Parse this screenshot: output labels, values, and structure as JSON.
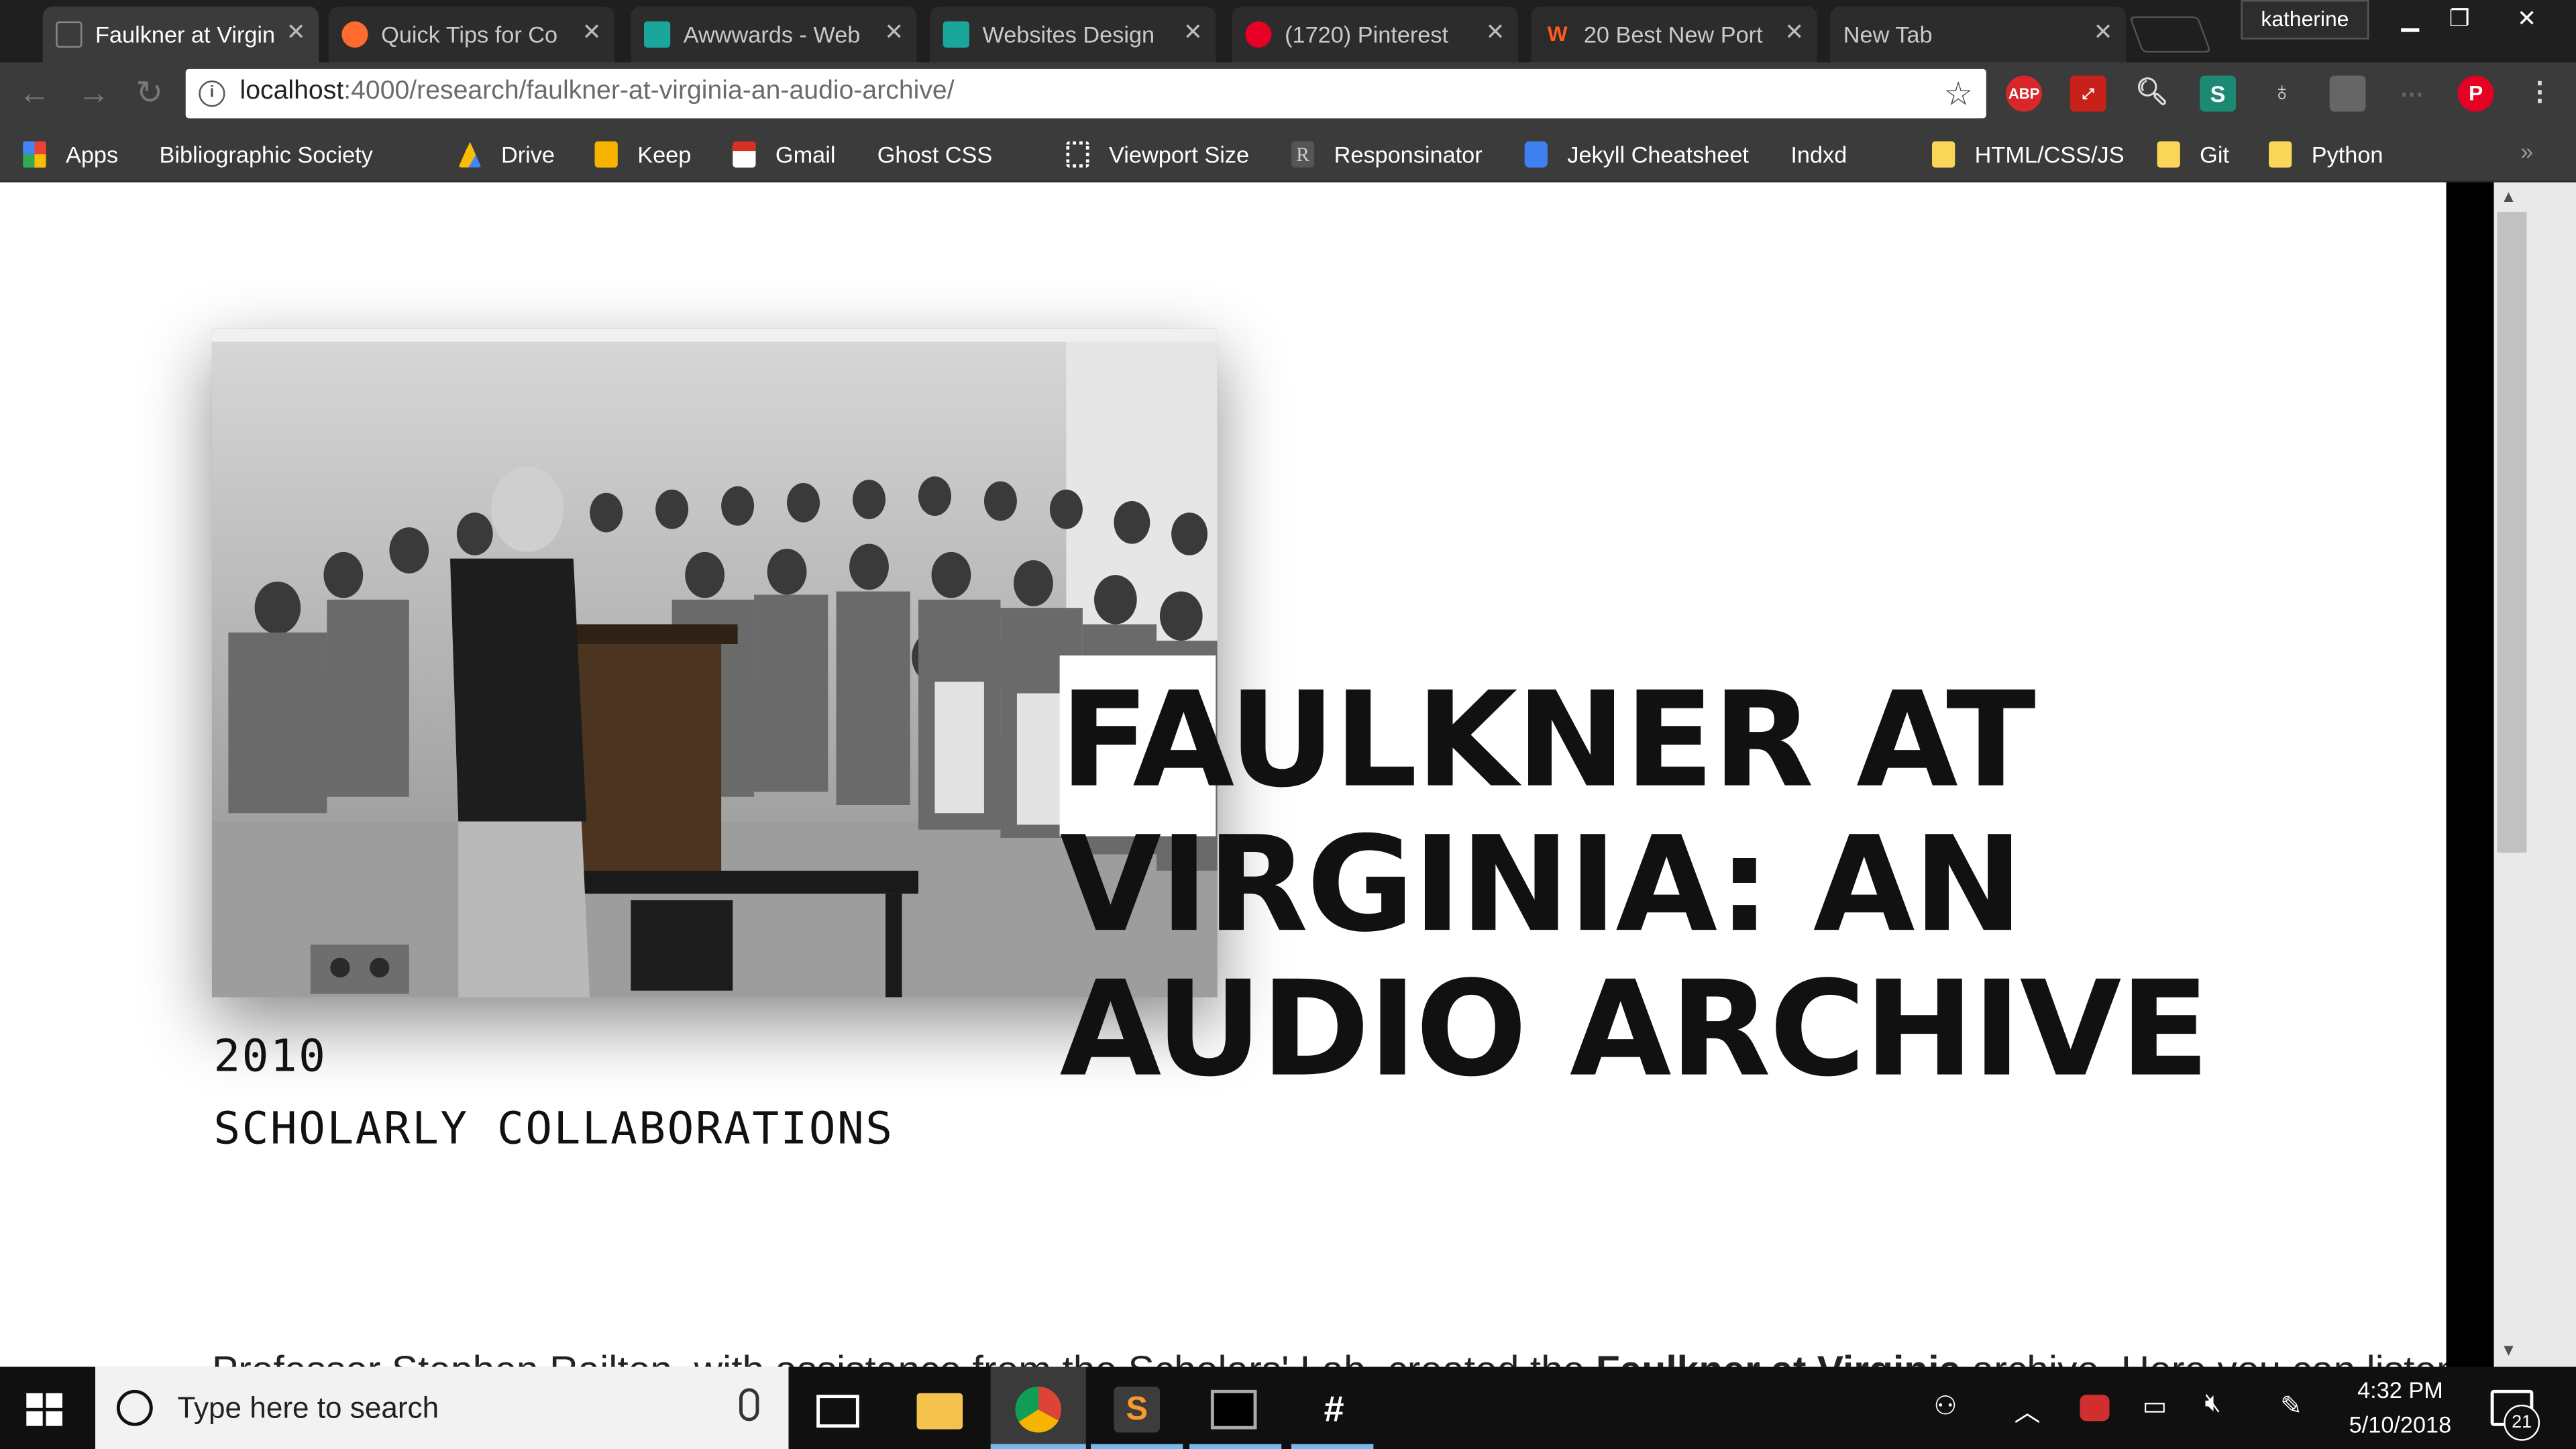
{
  "browser": {
    "tabs": [
      {
        "title": "Faulkner at Virgin",
        "active": true
      },
      {
        "title": "Quick Tips for Co",
        "active": false
      },
      {
        "title": "Awwwards - Web",
        "active": false
      },
      {
        "title": "Websites Design",
        "active": false
      },
      {
        "title": "(1720) Pinterest",
        "active": false
      },
      {
        "title": "20 Best New Port",
        "active": false
      },
      {
        "title": "New Tab",
        "active": false
      }
    ],
    "profile_name": "katherine",
    "address": {
      "host": "localhost",
      "rest": ":4000/research/faulkner-at-virginia-an-audio-archive/"
    },
    "extensions": [
      "ABP"
    ],
    "bookmarks": [
      "Apps",
      "Bibliographic Society",
      "Drive",
      "Keep",
      "Gmail",
      "Ghost CSS",
      "Viewport Size",
      "Responsinator",
      "Jekyll Cheatsheet",
      "Indxd",
      "HTML/CSS/JS",
      "Git",
      "Python"
    ],
    "bookmark_more": "»"
  },
  "page": {
    "title": "FAULKNER AT VIRGINIA: AN AUDIO ARCHIVE",
    "year": "2010",
    "category": "SCHOLARLY COLLABORATIONS",
    "intro_start": "Professor Stephen Railton, with assistance from the Scholars' Lab, created the ",
    "intro_bold": "Faulkner at Virginia",
    "intro_end": " archive. Here you can listen"
  },
  "taskbar": {
    "search_placeholder": "Type here to search",
    "time": "4:32 PM",
    "date": "5/10/2018",
    "notification_count": "21"
  },
  "colors": {
    "accent": "#76b9ed",
    "chrome_dark": "#3b3b3b",
    "pinterest": "#e60023"
  }
}
